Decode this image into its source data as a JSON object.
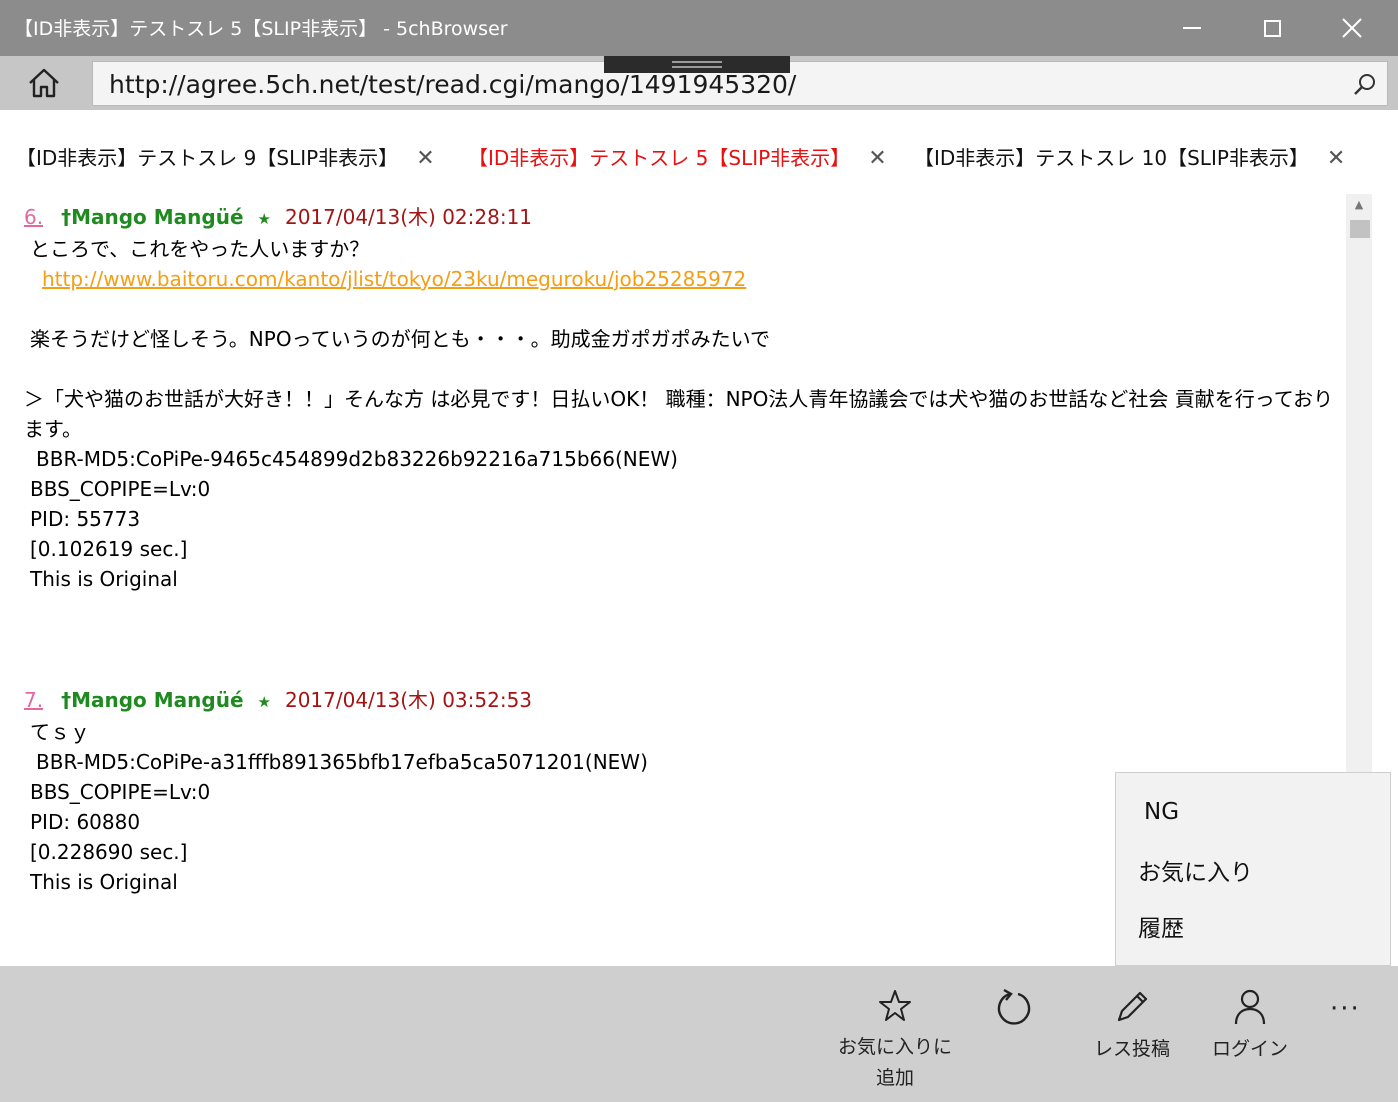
{
  "window": {
    "title": "【ID非表示】テストスレ 5【SLIP非表示】 - 5chBrowser"
  },
  "address_bar": {
    "url": "http://agree.5ch.net/test/read.cgi/mango/1491945320/"
  },
  "tabs": [
    {
      "label": "【ID非表示】テストスレ 9【SLIP非表示】",
      "close": "✕",
      "active": false
    },
    {
      "label": "【ID非表示】テストスレ 5【SLIP非表示】",
      "close": "✕",
      "active": true
    },
    {
      "label": "【ID非表示】テストスレ 10【SLIP非表示】",
      "close": "✕",
      "active": false
    }
  ],
  "posts": [
    {
      "number": "6.",
      "name": "†Mango Mangüé",
      "star": "★",
      "date": "2017/04/13(木) 02:28:11",
      "line1": "ところで、これをやった人いますか？",
      "link": "http://www.baitoru.com/kanto/jlist/tokyo/23ku/meguroku/job25285972",
      "line2": "楽そうだけど怪しそう。NPOっていうのが何とも・・・。助成金ガポガポみたいで",
      "quote": "＞「犬や猫のお世話が大好き！！」そんな方 は必見です！日払いOK！ 職種：NPO法人青年協議会では犬や猫のお世話など社会 貢献を行っております。",
      "md5": "BBR-MD5:CoPiPe-9465c454899d2b83226b92216a715b66(NEW)",
      "copipe": "BBS_COPIPE=Lv:0",
      "pid": "PID: 55773",
      "sec": "[0.102619 sec.]",
      "original": "This is Original"
    },
    {
      "number": "7.",
      "name": "†Mango Mangüé",
      "star": "★",
      "date": "2017/04/13(木) 03:52:53",
      "line1": "てｓｙ",
      "md5": "BBR-MD5:CoPiPe-a31fffb891365bfb17efba5ca5071201(NEW)",
      "copipe": "BBS_COPIPE=Lv:0",
      "pid": "PID: 60880",
      "sec": "[0.228690 sec.]",
      "original": "This is Original"
    }
  ],
  "overflow_menu": {
    "items": [
      "NG",
      "お気に入り",
      "履歴"
    ]
  },
  "command_bar": {
    "add_favorite_line1": "お気に入りに",
    "add_favorite_line2": "追加",
    "post_reply": "レス投稿",
    "login": "ログイン",
    "more": "···"
  },
  "icons": {
    "home": "home-icon",
    "search": "search-icon",
    "favorite": "star-outline-icon",
    "refresh": "refresh-icon",
    "post": "pencil-icon",
    "login": "person-icon",
    "more": "more-icon"
  }
}
